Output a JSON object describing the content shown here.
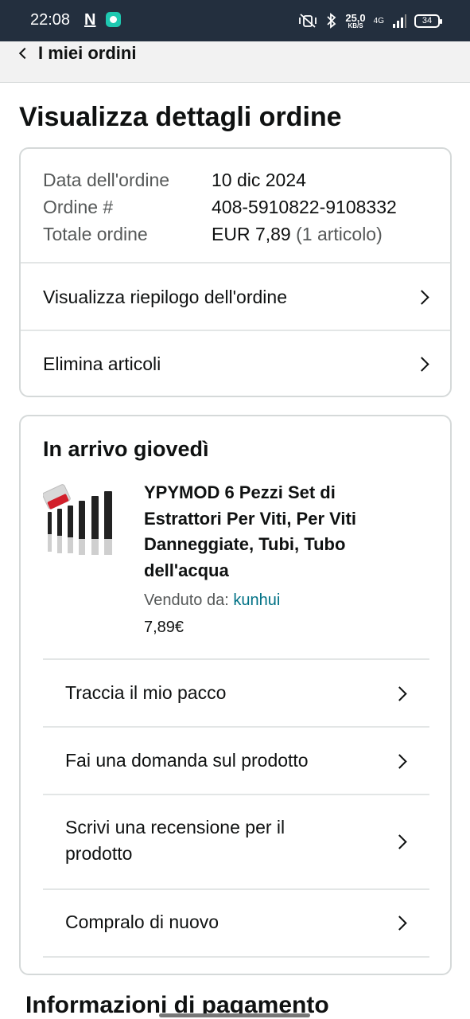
{
  "status_bar": {
    "time": "22:08",
    "n_badge": "N",
    "net_speed_value": "25,0",
    "net_speed_unit": "KB/S",
    "network": "4G",
    "battery": "34"
  },
  "nav": {
    "back_label": "I miei ordini"
  },
  "page_title": "Visualizza dettagli ordine",
  "order": {
    "date_label": "Data dell'ordine",
    "date_value": "10 dic 2024",
    "number_label": "Ordine #",
    "number_value": "408-5910822-9108332",
    "total_label": "Totale ordine",
    "total_value": "EUR 7,89",
    "total_count": "(1 articolo)",
    "summary_link": "Visualizza riepilogo dell'ordine",
    "delete_link": "Elimina articoli"
  },
  "shipment": {
    "heading": "In arrivo giovedì",
    "product_title": "YPYMOD 6 Pezzi Set di Estrattori Per Viti, Per Viti Danneggiate, Tubi, Tubo dell'acqua",
    "sold_by_label": "Venduto da:",
    "seller": "kunhui",
    "price": "7,89€",
    "actions": {
      "track": "Traccia il mio pacco",
      "ask": "Fai una domanda sul prodotto",
      "review": "Scrivi una recensione per il prodotto",
      "rebuy": "Compralo di nuovo"
    }
  },
  "payment_heading": "Informazioni di pagamento",
  "colors": {
    "header_bg": "#232f3e",
    "link": "#007185",
    "muted": "#565959"
  }
}
